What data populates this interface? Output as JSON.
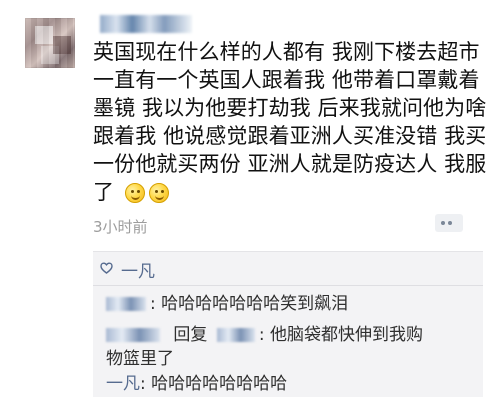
{
  "post": {
    "lines": [
      "英国现在什么样的人都有 我刚下楼去超市",
      "一直有一个英国人跟着我 他带着口罩戴着",
      "墨镜 我以为他要打劫我 后来我就问他为啥",
      "跟着我 他说感觉跟着亚洲人买准没错 我买",
      "一份他就买两份 亚洲人就是防疫达人 我服",
      "了"
    ],
    "timestamp": "3小时前"
  },
  "likes": {
    "name": "一凡"
  },
  "comments": [
    {
      "text": "哈哈哈哈哈哈哈笑到飙泪"
    },
    {
      "reply_word": "回复",
      "text_line1": "他脑袋都快伸到我购",
      "text_line2": "物篮里了"
    },
    {
      "name": "一凡",
      "text": "哈哈哈哈哈哈哈哈"
    }
  ],
  "icons": {
    "like": "heart-outline-icon",
    "actions": "more-actions-icon",
    "emoji": "smiling-face-icon"
  }
}
